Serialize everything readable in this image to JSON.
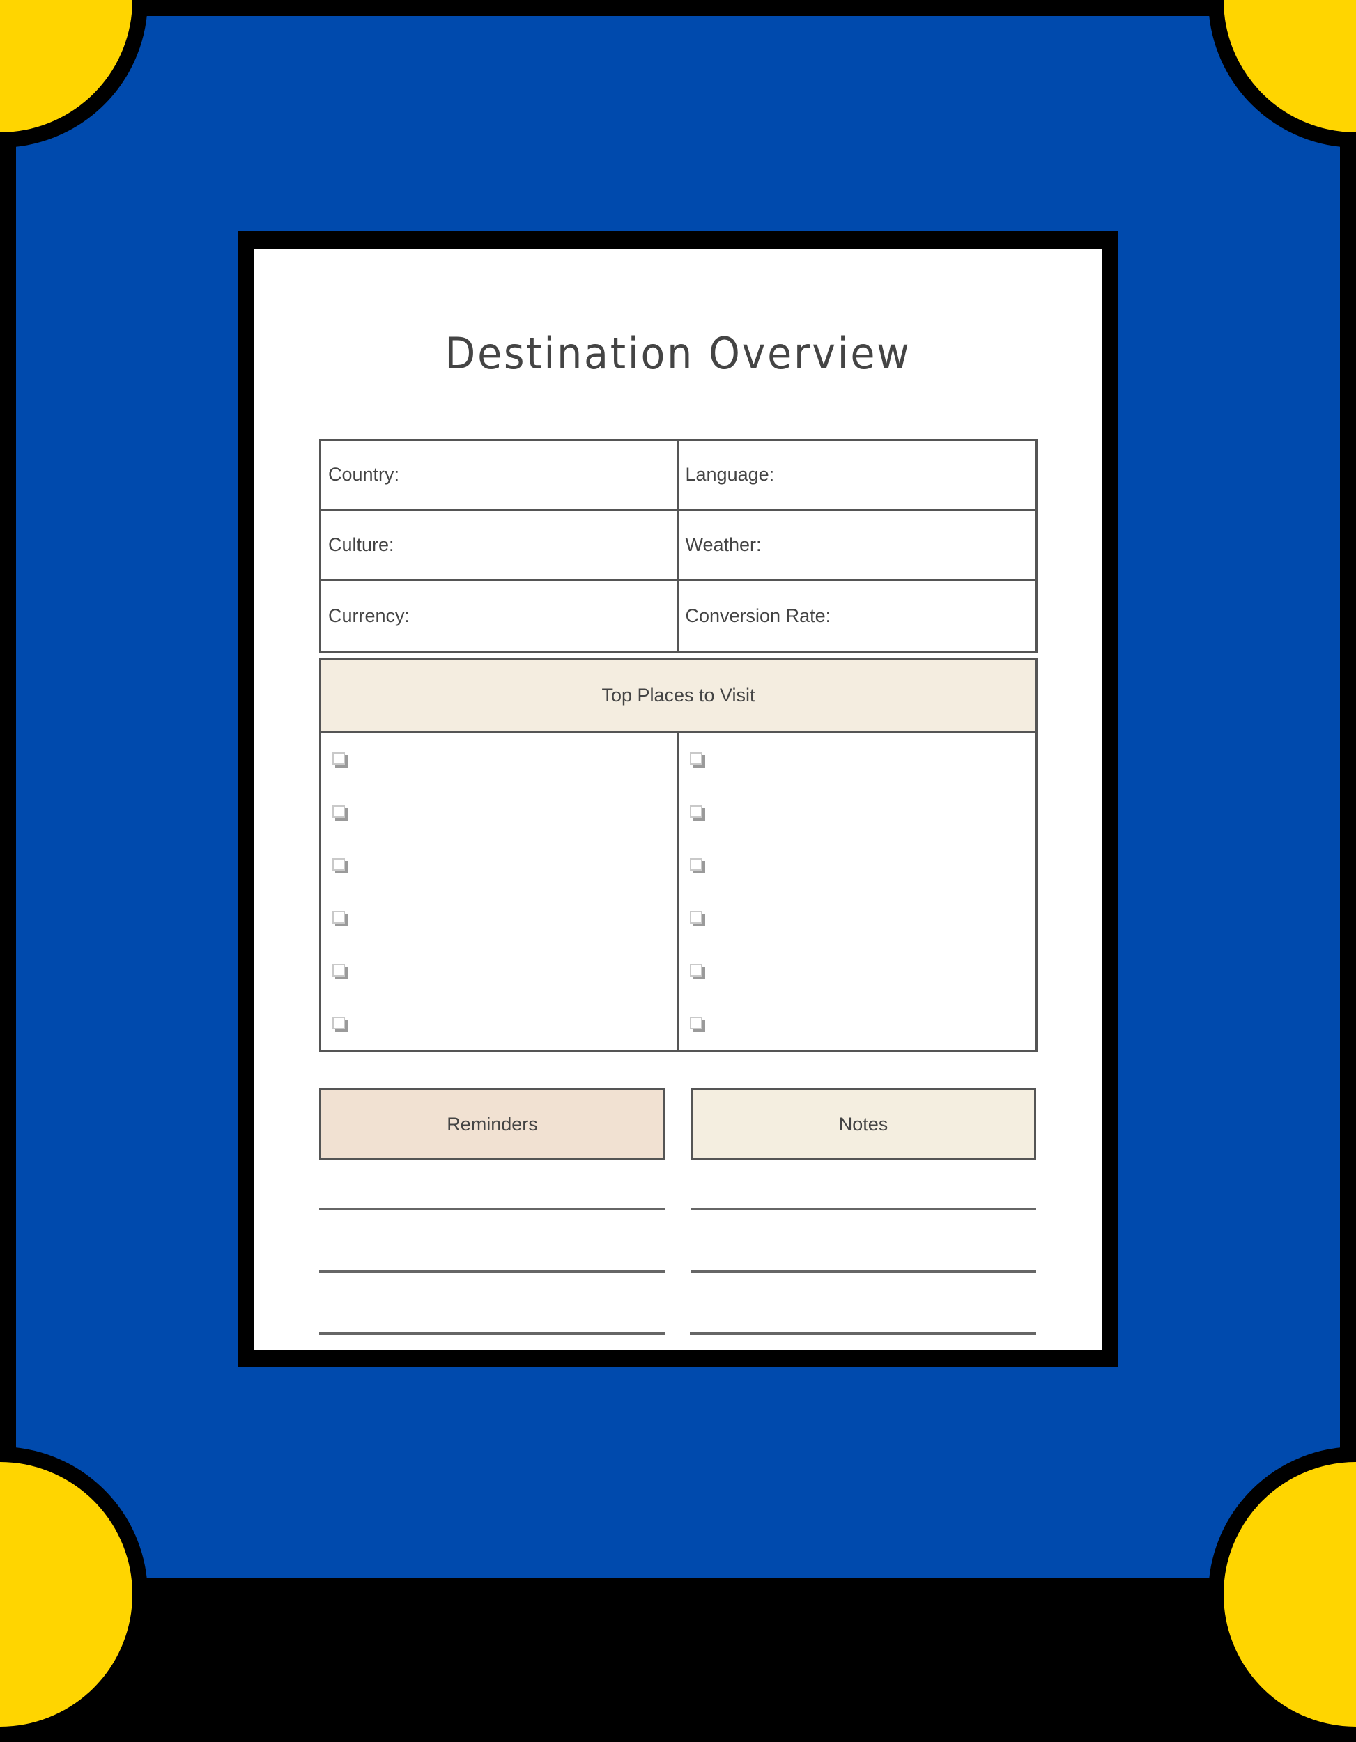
{
  "colors": {
    "background_blue": "#004aad",
    "corner_yellow": "#ffd500",
    "border_black": "#000000",
    "places_header_bg": "#f4ede0",
    "reminders_bg": "#f1e1d2",
    "notes_bg": "#f4eee0",
    "text": "#444444"
  },
  "document": {
    "title": "Destination Overview",
    "info_fields": [
      {
        "label": "Country:",
        "value": ""
      },
      {
        "label": "Language:",
        "value": ""
      },
      {
        "label": "Culture:",
        "value": ""
      },
      {
        "label": "Weather:",
        "value": ""
      },
      {
        "label": "Currency:",
        "value": ""
      },
      {
        "label": "Conversion Rate:",
        "value": ""
      }
    ],
    "places": {
      "heading": "Top Places to Visit",
      "checkbox_icon": "checkbox-unchecked-icon",
      "left": [
        false,
        false,
        false,
        false,
        false,
        false
      ],
      "right": [
        false,
        false,
        false,
        false,
        false,
        false
      ]
    },
    "reminders": {
      "heading": "Reminders",
      "lines": [
        "",
        "",
        ""
      ]
    },
    "notes": {
      "heading": "Notes",
      "lines": [
        "",
        "",
        ""
      ]
    }
  }
}
